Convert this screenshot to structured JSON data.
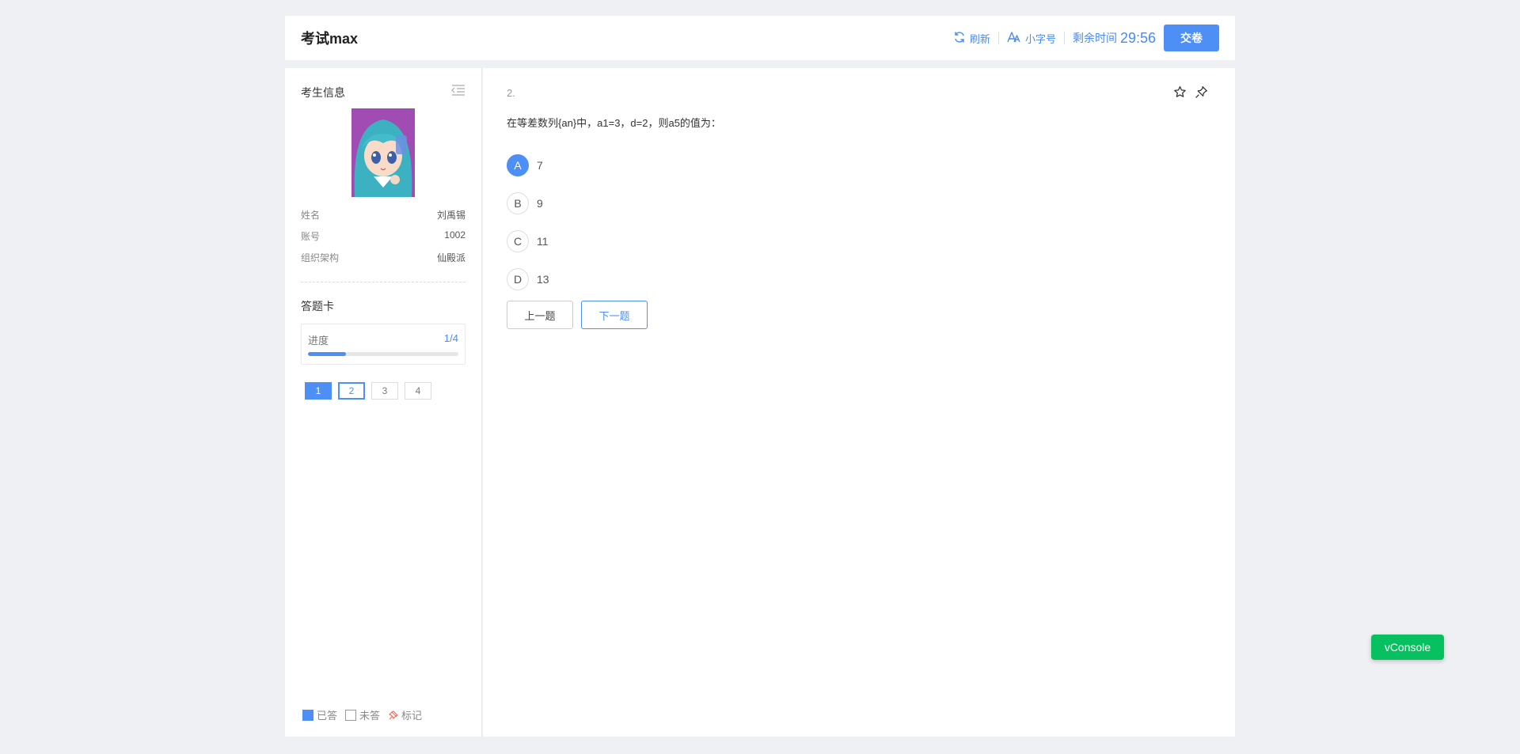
{
  "header": {
    "title": "考试max",
    "refresh_label": "刷新",
    "font_size_label": "小字号",
    "time_label": "剩余时间",
    "time_value": "29:56",
    "submit_label": "交卷"
  },
  "sidebar": {
    "info_title": "考生信息",
    "info": [
      {
        "label": "姓名",
        "value": "刘禹锡"
      },
      {
        "label": "账号",
        "value": "1002"
      },
      {
        "label": "组织架构",
        "value": "仙殿派"
      }
    ],
    "card_title": "答题卡",
    "progress": {
      "label": "进度",
      "count": "1/4",
      "fraction": 0.25
    },
    "questions": [
      {
        "num": "1",
        "state": "answered"
      },
      {
        "num": "2",
        "state": "current"
      },
      {
        "num": "3",
        "state": "unanswered"
      },
      {
        "num": "4",
        "state": "unanswered"
      }
    ],
    "legend": {
      "answered": "已答",
      "unanswered": "未答",
      "marked": "标记"
    }
  },
  "question": {
    "number": "2.",
    "text": "在等差数列{an}中，a1=3，d=2，则a5的值为：",
    "options": [
      {
        "key": "A",
        "text": "7",
        "selected": true
      },
      {
        "key": "B",
        "text": "9",
        "selected": false
      },
      {
        "key": "C",
        "text": "11",
        "selected": false
      },
      {
        "key": "D",
        "text": "13",
        "selected": false
      }
    ],
    "prev_label": "上一题",
    "next_label": "下一题"
  },
  "vconsole_label": "vConsole",
  "colors": {
    "accent": "#4d8ff5",
    "vconsole": "#07c160"
  },
  "icons": [
    "refresh-icon",
    "font-size-icon",
    "menu-toggle-icon",
    "star-icon",
    "pin-icon",
    "mark-icon"
  ]
}
